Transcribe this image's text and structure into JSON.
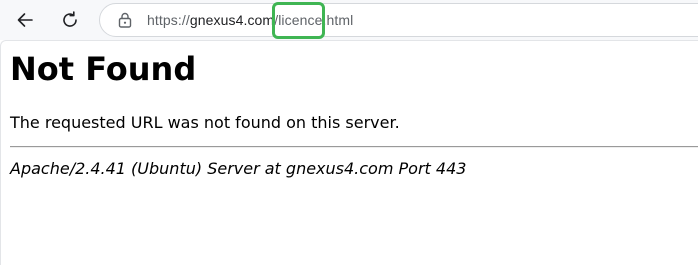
{
  "browser": {
    "url_prefix": "https://",
    "url_domain": "gnexus4.com",
    "url_path": "/licence.html",
    "icons": {
      "back": "arrow-left-icon",
      "refresh": "refresh-icon",
      "lock": "lock-icon"
    },
    "highlight_color": "#3fb553"
  },
  "page": {
    "title": "Not Found",
    "message": "The requested URL was not found on this server.",
    "server_signature": "Apache/2.4.41 (Ubuntu) Server at gnexus4.com Port 443"
  }
}
